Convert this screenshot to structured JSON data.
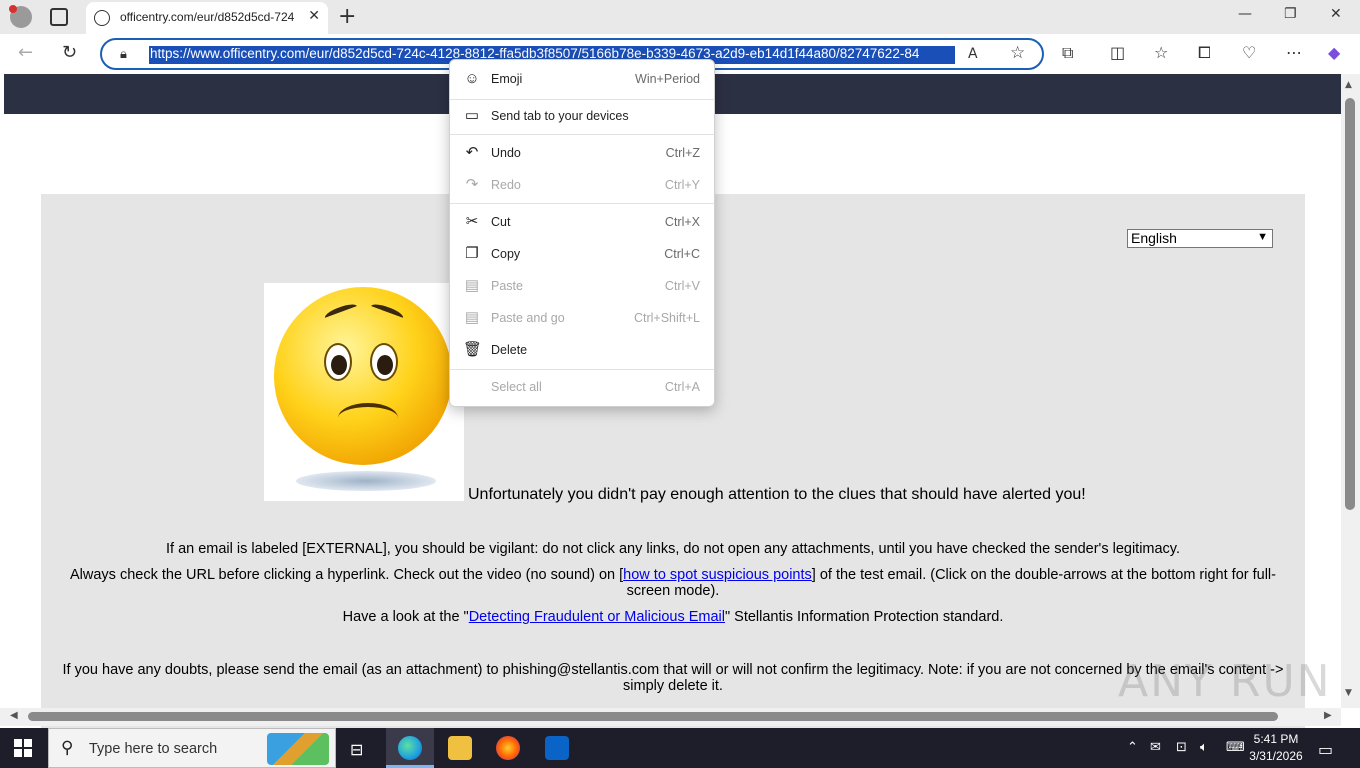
{
  "browser": {
    "tab_title": "officentry.com/eur/d852d5cd-724",
    "tab_close": "✕",
    "new_tab": "+",
    "window_controls": {
      "minimize": "—",
      "restore": "❐",
      "close": "✕"
    },
    "nav": {
      "back": "←",
      "refresh": "↻"
    },
    "address": {
      "url": "https://www.officentry.com/eur/d852d5cd-724c-4128-8812-ffa5db3f8507/5166b78e-b339-4673-a2d9-eb14d1f44a80/82747622-84",
      "read_aloud": "A",
      "favorite": "☆"
    },
    "toolbar_icons": [
      "extensions-icon",
      "split-screen-icon",
      "favorites-icon",
      "collections-icon",
      "browser-essentials-icon",
      "more-icon",
      "copilot-icon"
    ]
  },
  "context_menu": {
    "items": [
      {
        "label": "Emoji",
        "shortcut": "Win+Period",
        "icon": "☺",
        "enabled": true
      },
      {
        "label": "Send tab to your devices",
        "shortcut": "",
        "icon": "▭",
        "enabled": true
      },
      {
        "label": "Undo",
        "shortcut": "Ctrl+Z",
        "icon": "↶",
        "enabled": true
      },
      {
        "label": "Redo",
        "shortcut": "Ctrl+Y",
        "icon": "↷",
        "enabled": false
      },
      {
        "label": "Cut",
        "shortcut": "Ctrl+X",
        "icon": "✂",
        "enabled": true
      },
      {
        "label": "Copy",
        "shortcut": "Ctrl+C",
        "icon": "❐",
        "enabled": true
      },
      {
        "label": "Paste",
        "shortcut": "Ctrl+V",
        "icon": "▤",
        "enabled": false
      },
      {
        "label": "Paste and go",
        "shortcut": "Ctrl+Shift+L",
        "icon": "▤",
        "enabled": false
      },
      {
        "label": "Delete",
        "shortcut": "",
        "icon": "🗑",
        "enabled": true
      },
      {
        "label": "Select all",
        "shortcut": "Ctrl+A",
        "icon": "",
        "enabled": false
      }
    ]
  },
  "page": {
    "language_select": "English",
    "headline": "Unfortunately you didn't pay enough attention to the clues that should have alerted you!",
    "para1": "If an email is labeled [EXTERNAL], you should be vigilant: do not click any links, do not open any attachments, until you have checked the sender's legitimacy.",
    "para2_before": "Always check the URL before clicking a hyperlink. Check out the video (no sound) on [",
    "para2_link": "how to spot suspicious points",
    "para2_after": "] of the test email. (Click on the double-arrows at the bottom right for full-screen mode).",
    "para3_before": "Have a look at the \"",
    "para3_link": "Detecting Fraudulent or Malicious Email",
    "para3_after": "\" Stellantis Information Protection standard.",
    "para4": "If you have any doubts, please send the email (as an attachment) to phishing@stellantis.com that will or will not confirm the legitimacy. Note: if you are not concerned by the email's content -> simply delete it."
  },
  "watermark": "ANY RUN",
  "taskbar": {
    "search_placeholder": "Type here to search",
    "time": "5:41 PM",
    "date": "3/31/2026"
  },
  "colors": {
    "page_band": "#2c3043",
    "address_highlight": "#1a4fb8",
    "link": "#0000ee",
    "taskbar": "#1e1e2a"
  }
}
